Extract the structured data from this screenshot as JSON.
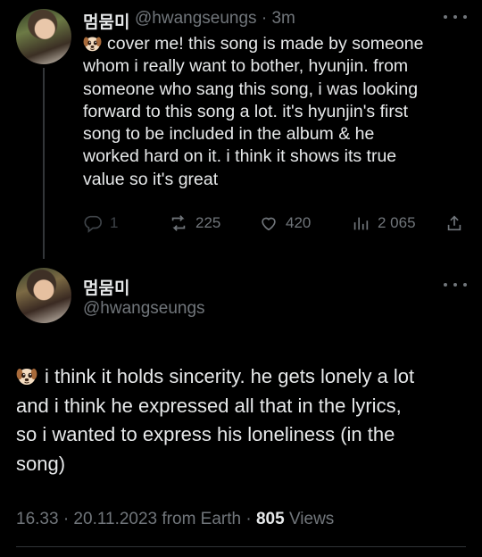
{
  "tweet1": {
    "name": "멈뭄미",
    "handle": "@hwangseungs",
    "time": "3m",
    "text": "cover me! this song is made by someone\nwhom i really want to bother, hyunjin. from\nsomeone who sang this song, i was looking\nforward to this song a lot. it's hyunjin's first\nsong to be included in the album & he\nworked hard on it. i think it shows its true\nvalue so it's great",
    "replies": "1",
    "reposts": "225",
    "likes": "420",
    "views": "2 065"
  },
  "tweet2": {
    "name": "멈뭄미",
    "handle": "@hwangseungs",
    "text": "i think it holds sincerity. he gets lonely a lot\nand i think he expressed all that in the lyrics,\nso i wanted to express his loneliness (in the\nsong)",
    "timestamp": "16.33 · 20.11.2023 from Earth · ",
    "views_count": "805",
    "views_label": "Views"
  },
  "icons": {
    "emoji": "puppy-emoji",
    "reply": "reply-icon",
    "repost": "repost-icon",
    "like": "heart-icon",
    "views": "views-icon",
    "share": "share-icon",
    "more": "more-icon"
  }
}
